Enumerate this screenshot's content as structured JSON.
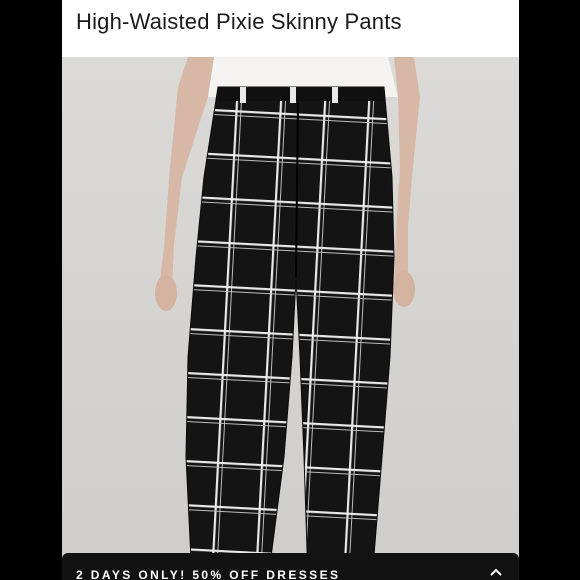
{
  "product": {
    "title": "High-Waisted Pixie Skinny Pants"
  },
  "image": {
    "alt": "Model wearing black windowpane plaid high-waisted skinny pants"
  },
  "promo": {
    "text": "2 DAYS ONLY! 50% OFF DRESSES",
    "expand_icon": "chevron-up-icon"
  },
  "colors": {
    "background": "#000000",
    "panel": "#ffffff",
    "pants": "#141414",
    "plaid_lines": "#e9e9e9",
    "banner": "#121212"
  }
}
